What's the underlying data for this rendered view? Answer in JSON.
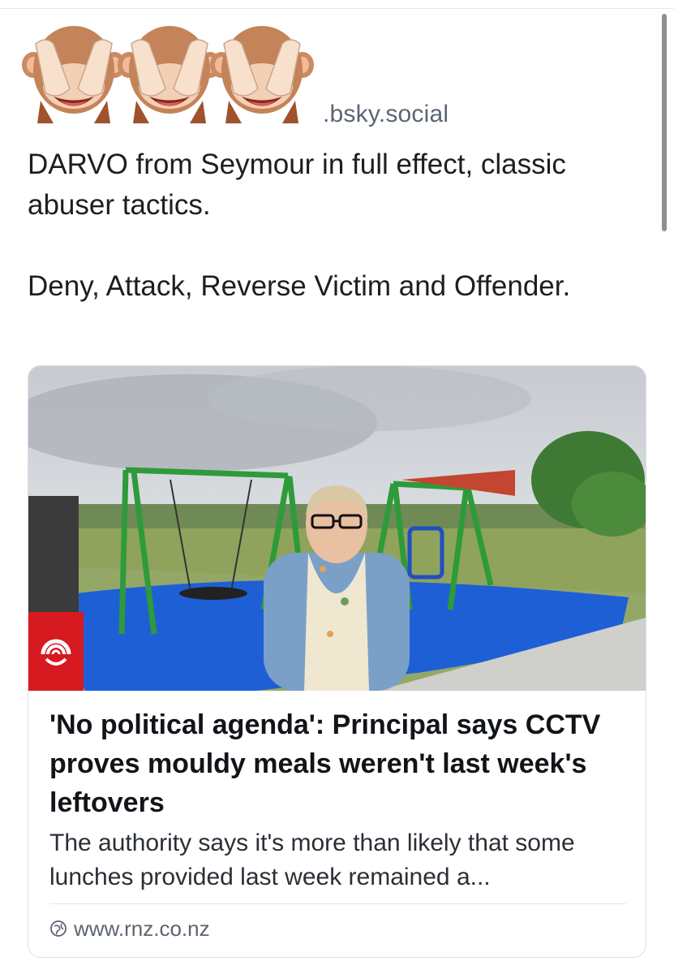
{
  "post": {
    "author_handle_suffix": ".bsky.social",
    "text_paragraph_1": "DARVO from Seymour in full effect, classic abuser tactics.",
    "text_paragraph_2": "Deny, Attack, Reverse Victim and Offender."
  },
  "avatar_cover_emoji": "see-no-evil-monkey-icon",
  "link_card": {
    "title": "'No political agenda': Principal says CCTV proves mouldy meals weren't last week's leftovers",
    "description": "The authority says it's more than likely that some lunches provided last week remained a...",
    "domain": "www.rnz.co.nz",
    "domain_icon": "globe-icon",
    "publisher_logo": "rnz-logo-icon",
    "image_description": "playground-photo"
  },
  "colors": {
    "rnz_red": "#d71920",
    "handle_grey": "#5a6573"
  }
}
